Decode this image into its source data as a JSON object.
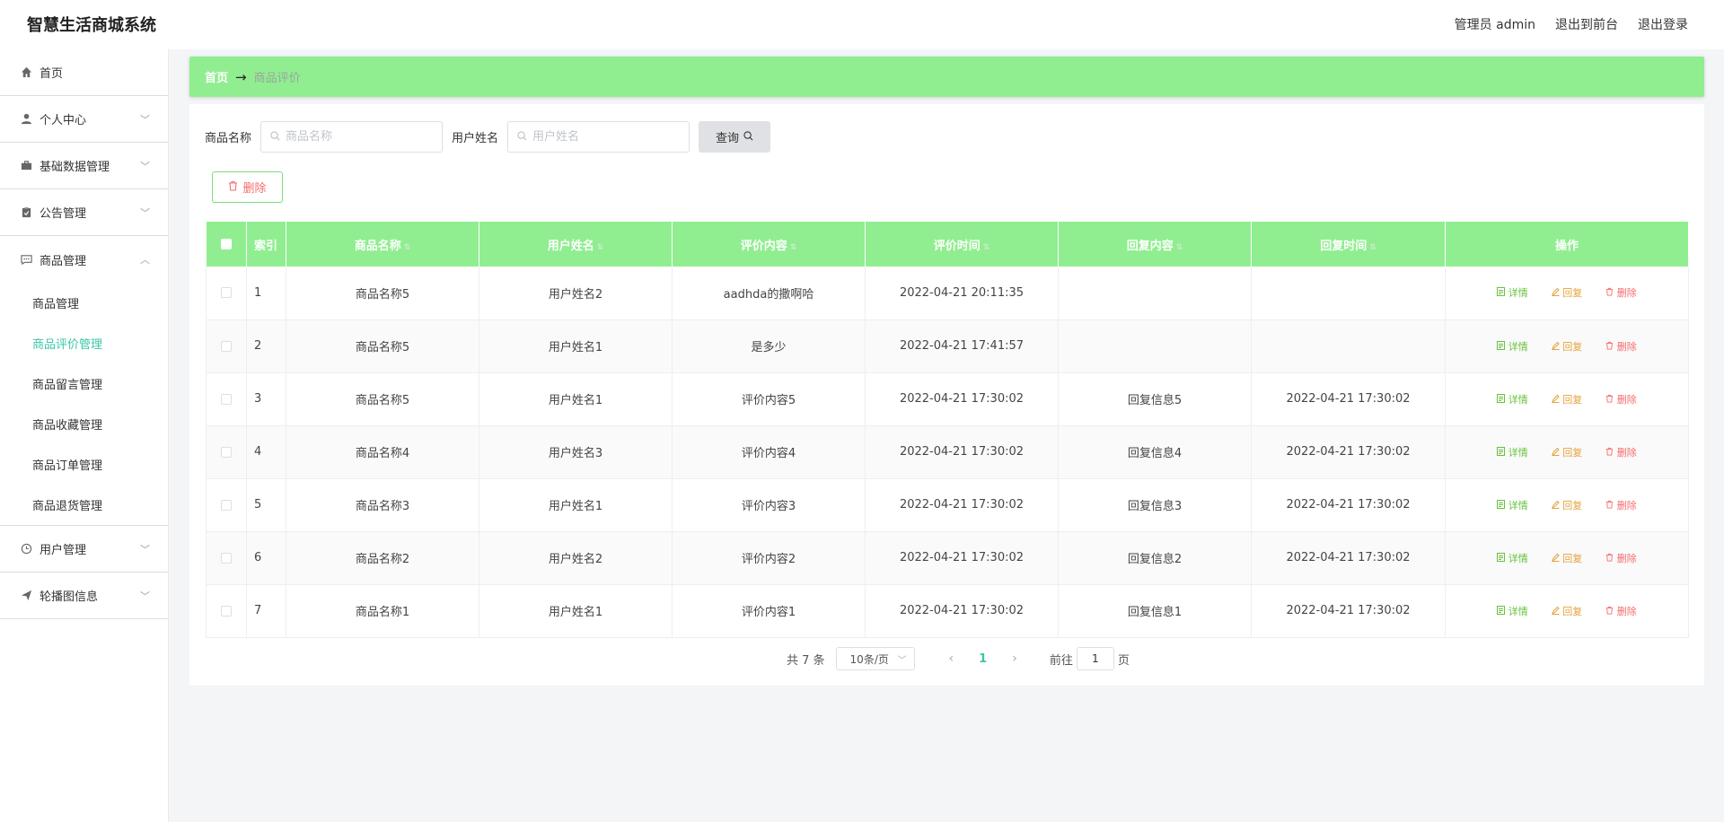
{
  "header": {
    "title": "智慧生活商城系统",
    "links": [
      "管理员 admin",
      "退出到前台",
      "退出登录"
    ]
  },
  "sidebar": {
    "items": [
      {
        "label": "首页",
        "icon": "home-icon",
        "expandable": false
      },
      {
        "label": "个人中心",
        "icon": "user-icon",
        "expandable": true
      },
      {
        "label": "基础数据管理",
        "icon": "briefcase-icon",
        "expandable": true
      },
      {
        "label": "公告管理",
        "icon": "clipboard-icon",
        "expandable": true
      },
      {
        "label": "商品管理",
        "icon": "chat-icon",
        "expandable": true,
        "expanded": true
      }
    ],
    "submenu": [
      {
        "label": "商品管理",
        "active": false
      },
      {
        "label": "商品评价管理",
        "active": true
      },
      {
        "label": "商品留言管理",
        "active": false
      },
      {
        "label": "商品收藏管理",
        "active": false
      },
      {
        "label": "商品订单管理",
        "active": false
      },
      {
        "label": "商品退货管理",
        "active": false
      }
    ],
    "items_after": [
      {
        "label": "用户管理",
        "icon": "clock-icon",
        "expandable": true
      },
      {
        "label": "轮播图信息",
        "icon": "send-icon",
        "expandable": true
      }
    ]
  },
  "breadcrumb": {
    "home": "首页",
    "arrow": "→",
    "current": "商品评价"
  },
  "search": {
    "product_label": "商品名称",
    "product_placeholder": "商品名称",
    "user_label": "用户姓名",
    "user_placeholder": "用户姓名",
    "query_label": "查询"
  },
  "toolbar": {
    "delete_label": "删除"
  },
  "table": {
    "headers": [
      "索引",
      "商品名称",
      "用户姓名",
      "评价内容",
      "评价时间",
      "回复内容",
      "回复时间",
      "操作"
    ],
    "rows": [
      {
        "idx": "1",
        "product": "商品名称5",
        "user": "用户姓名2",
        "content": "aadhda的撒啊哈",
        "time": "2022-04-21 20:11:35",
        "reply": "",
        "reply_time": ""
      },
      {
        "idx": "2",
        "product": "商品名称5",
        "user": "用户姓名1",
        "content": "是多少",
        "time": "2022-04-21 17:41:57",
        "reply": "",
        "reply_time": ""
      },
      {
        "idx": "3",
        "product": "商品名称5",
        "user": "用户姓名1",
        "content": "评价内容5",
        "time": "2022-04-21 17:30:02",
        "reply": "回复信息5",
        "reply_time": "2022-04-21 17:30:02"
      },
      {
        "idx": "4",
        "product": "商品名称4",
        "user": "用户姓名3",
        "content": "评价内容4",
        "time": "2022-04-21 17:30:02",
        "reply": "回复信息4",
        "reply_time": "2022-04-21 17:30:02"
      },
      {
        "idx": "5",
        "product": "商品名称3",
        "user": "用户姓名1",
        "content": "评价内容3",
        "time": "2022-04-21 17:30:02",
        "reply": "回复信息3",
        "reply_time": "2022-04-21 17:30:02"
      },
      {
        "idx": "6",
        "product": "商品名称2",
        "user": "用户姓名2",
        "content": "评价内容2",
        "time": "2022-04-21 17:30:02",
        "reply": "回复信息2",
        "reply_time": "2022-04-21 17:30:02"
      },
      {
        "idx": "7",
        "product": "商品名称1",
        "user": "用户姓名1",
        "content": "评价内容1",
        "time": "2022-04-21 17:30:02",
        "reply": "回复信息1",
        "reply_time": "2022-04-21 17:30:02"
      }
    ],
    "actions": {
      "detail": "详情",
      "reply": "回复",
      "delete": "删除"
    }
  },
  "pagination": {
    "total": "共 7 条",
    "page_size": "10条/页",
    "current_page": "1",
    "goto_label": "前往",
    "goto_value": "1",
    "goto_unit": "页"
  },
  "colors": {
    "accent_green": "#90ee90",
    "active_menu": "#3cc5a6",
    "detail": "#67c23a",
    "reply": "#e6a23c",
    "delete": "#f56c6c"
  }
}
